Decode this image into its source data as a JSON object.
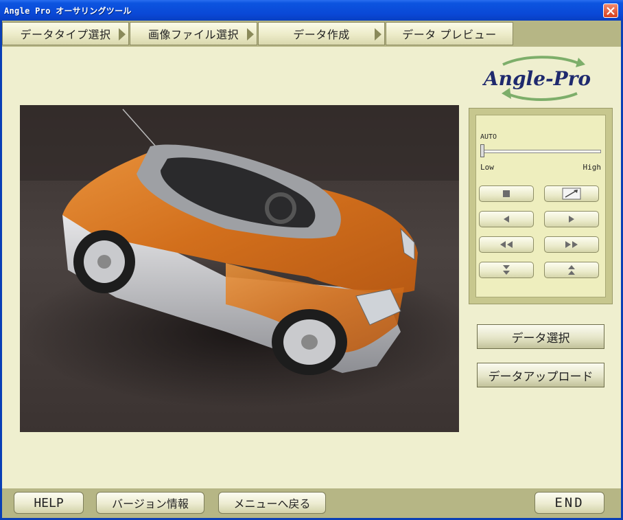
{
  "window": {
    "title": "Angle Pro オーサリングツール",
    "close_icon": "close-icon"
  },
  "steps": [
    {
      "label": "データタイプ選択",
      "arrow": true
    },
    {
      "label": "画像ファイル選択",
      "arrow": true
    },
    {
      "label": "データ作成",
      "arrow": true
    },
    {
      "label": "データ プレビュー",
      "arrow": false
    }
  ],
  "logo": {
    "text": "Angle-Pro"
  },
  "preview": {
    "image": "orange-silver-roadster-car-photo"
  },
  "control": {
    "auto_label": "AUTO",
    "speed_level": 0,
    "low_label": "Low",
    "high_label": "High",
    "buttons": [
      {
        "icon": "stop-icon"
      },
      {
        "icon": "expand-icon"
      },
      {
        "icon": "step-left-icon"
      },
      {
        "icon": "step-right-icon"
      },
      {
        "icon": "rewind-icon"
      },
      {
        "icon": "fast-forward-icon"
      },
      {
        "icon": "tilt-down-icon"
      },
      {
        "icon": "tilt-up-icon"
      }
    ]
  },
  "actions": {
    "select_data": "データ選択",
    "upload_data": "データアップロード"
  },
  "bottom": {
    "help": "HELP",
    "version": "バージョン情報",
    "back_to_menu": "メニューへ戻る",
    "end": "END"
  },
  "colors": {
    "background": "#efefcf",
    "bar": "#b6b685",
    "titlebar": "#0a48d6",
    "accent_orange": "#d9761f"
  }
}
